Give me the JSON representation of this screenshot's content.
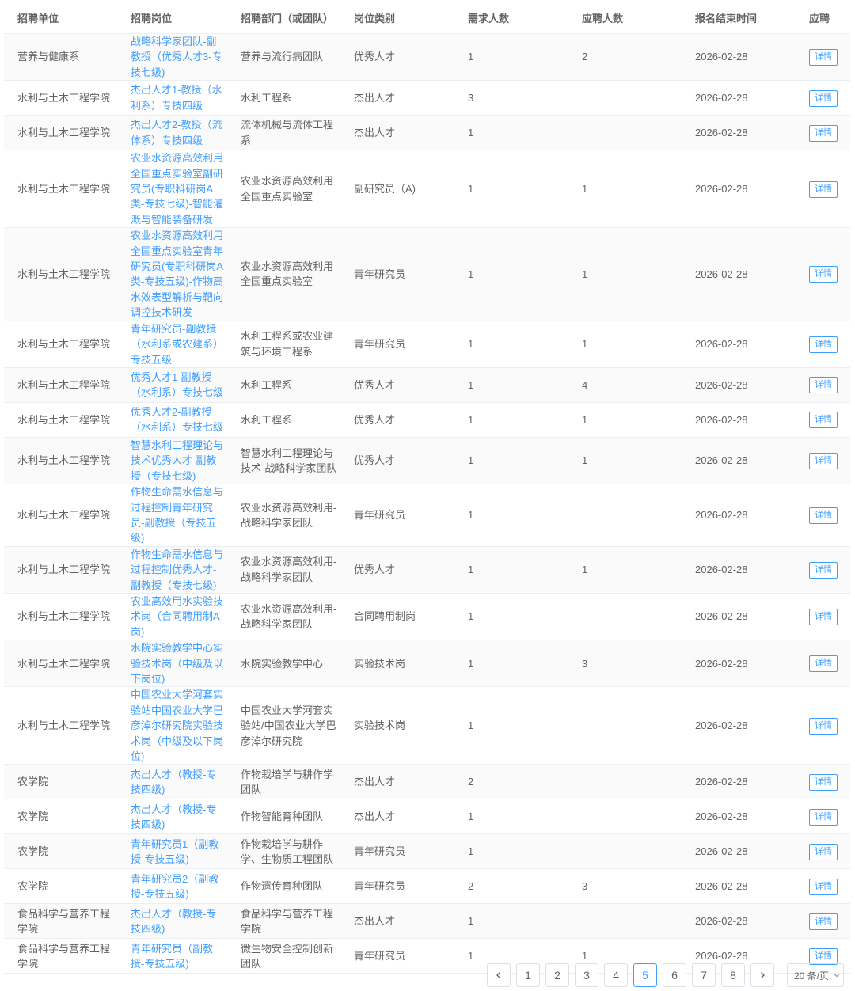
{
  "table": {
    "headers": [
      "招聘单位",
      "招聘岗位",
      "招聘部门（或团队）",
      "岗位类别",
      "需求人数",
      "应聘人数",
      "报名结束时间",
      "应聘"
    ],
    "detail_label": "详情",
    "rows": [
      {
        "unit": "营养与健康系",
        "position": "战略科学家团队-副教授（优秀人才3-专技七级)",
        "dept": "营养与流行病团队",
        "category": "优秀人才",
        "need": "1",
        "applied": "2",
        "deadline": "2026-02-28"
      },
      {
        "unit": "水利与土木工程学院",
        "position": "杰出人才1-教授（水利系）专技四级",
        "dept": "水利工程系",
        "category": "杰出人才",
        "need": "3",
        "applied": "",
        "deadline": "2026-02-28"
      },
      {
        "unit": "水利与土木工程学院",
        "position": "杰出人才2-教授（流体系）专技四级",
        "dept": "流体机械与流体工程系",
        "category": "杰出人才",
        "need": "1",
        "applied": "",
        "deadline": "2026-02-28"
      },
      {
        "unit": "水利与土木工程学院",
        "position": "农业水资源高效利用全国重点实验室副研究员(专职科研岗A类-专技七级)-智能灌溉与智能装备研发",
        "dept": "农业水资源高效利用全国重点实验室",
        "category": "副研究员（A)",
        "need": "1",
        "applied": "1",
        "deadline": "2026-02-28"
      },
      {
        "unit": "水利与土木工程学院",
        "position": "农业水资源高效利用全国重点实验室青年研究员(专职科研岗A类-专技五级)-作物高水效表型解析与靶向调控技术研发",
        "dept": "农业水资源高效利用全国重点实验室",
        "category": "青年研究员",
        "need": "1",
        "applied": "1",
        "deadline": "2026-02-28"
      },
      {
        "unit": "水利与土木工程学院",
        "position": "青年研究员-副教授（水利系或农建系）专技五级",
        "dept": "水利工程系或农业建筑与环境工程系",
        "category": "青年研究员",
        "need": "1",
        "applied": "1",
        "deadline": "2026-02-28"
      },
      {
        "unit": "水利与土木工程学院",
        "position": "优秀人才1-副教授（水利系）专技七级",
        "dept": "水利工程系",
        "category": "优秀人才",
        "need": "1",
        "applied": "4",
        "deadline": "2026-02-28"
      },
      {
        "unit": "水利与土木工程学院",
        "position": "优秀人才2-副教授（水利系）专技七级",
        "dept": "水利工程系",
        "category": "优秀人才",
        "need": "1",
        "applied": "1",
        "deadline": "2026-02-28"
      },
      {
        "unit": "水利与土木工程学院",
        "position": "智慧水利工程理论与技术优秀人才-副教授（专技七级)",
        "dept": "智慧水利工程理论与技术-战略科学家团队",
        "category": "优秀人才",
        "need": "1",
        "applied": "1",
        "deadline": "2026-02-28"
      },
      {
        "unit": "水利与土木工程学院",
        "position": "作物生命需水信息与过程控制青年研究员-副教授（专技五级)",
        "dept": "农业水资源高效利用-战略科学家团队",
        "category": "青年研究员",
        "need": "1",
        "applied": "",
        "deadline": "2026-02-28"
      },
      {
        "unit": "水利与土木工程学院",
        "position": "作物生命需水信息与过程控制优秀人才-副教授（专技七级)",
        "dept": "农业水资源高效利用-战略科学家团队",
        "category": "优秀人才",
        "need": "1",
        "applied": "1",
        "deadline": "2026-02-28"
      },
      {
        "unit": "水利与土木工程学院",
        "position": "农业高效用水实验技术岗（合同聘用制A岗)",
        "dept": "农业水资源高效利用-战略科学家团队",
        "category": "合同聘用制岗",
        "need": "1",
        "applied": "",
        "deadline": "2026-02-28"
      },
      {
        "unit": "水利与土木工程学院",
        "position": "水院实验教学中心实验技术岗（中级及以下岗位)",
        "dept": "水院实验教学中心",
        "category": "实验技术岗",
        "need": "1",
        "applied": "3",
        "deadline": "2026-02-28"
      },
      {
        "unit": "水利与土木工程学院",
        "position": "中国农业大学河套实验站中国农业大学巴彦淖尔研究院实验技术岗（中级及以下岗位)",
        "dept": "中国农业大学河套实验站/中国农业大学巴彦淖尔研究院",
        "category": "实验技术岗",
        "need": "1",
        "applied": "",
        "deadline": "2026-02-28"
      },
      {
        "unit": "农学院",
        "position": "杰出人才（教授-专技四级)",
        "dept": "作物栽培学与耕作学团队",
        "category": "杰出人才",
        "need": "2",
        "applied": "",
        "deadline": "2026-02-28"
      },
      {
        "unit": "农学院",
        "position": "杰出人才（教授-专技四级)",
        "dept": "作物智能育种团队",
        "category": "杰出人才",
        "need": "1",
        "applied": "",
        "deadline": "2026-02-28"
      },
      {
        "unit": "农学院",
        "position": "青年研究员1（副教授-专技五级)",
        "dept": "作物栽培学与耕作学、生物质工程团队",
        "category": "青年研究员",
        "need": "1",
        "applied": "",
        "deadline": "2026-02-28"
      },
      {
        "unit": "农学院",
        "position": "青年研究员2（副教授-专技五级)",
        "dept": "作物遗传育种团队",
        "category": "青年研究员",
        "need": "2",
        "applied": "3",
        "deadline": "2026-02-28"
      },
      {
        "unit": "食品科学与营养工程学院",
        "position": "杰出人才（教授-专技四级)",
        "dept": "食品科学与营养工程学院",
        "category": "杰出人才",
        "need": "1",
        "applied": "",
        "deadline": "2026-02-28"
      },
      {
        "unit": "食品科学与营养工程学院",
        "position": "青年研究员（副教授-专技五级)",
        "dept": "微生物安全控制创新团队",
        "category": "青年研究员",
        "need": "1",
        "applied": "1",
        "deadline": "2026-02-28"
      }
    ]
  },
  "pagination": {
    "pages": [
      "1",
      "2",
      "3",
      "4",
      "5",
      "6",
      "7",
      "8"
    ],
    "current_page": "5",
    "page_size_label": "20 条/页",
    "prev_icon": "chevron-left-icon",
    "next_icon": "chevron-right-icon",
    "dropdown_icon": "chevron-down-icon"
  },
  "colors": {
    "accent": "#409eff",
    "text": "#606266",
    "stripe": "#fafafa",
    "border": "#ebeef5"
  }
}
